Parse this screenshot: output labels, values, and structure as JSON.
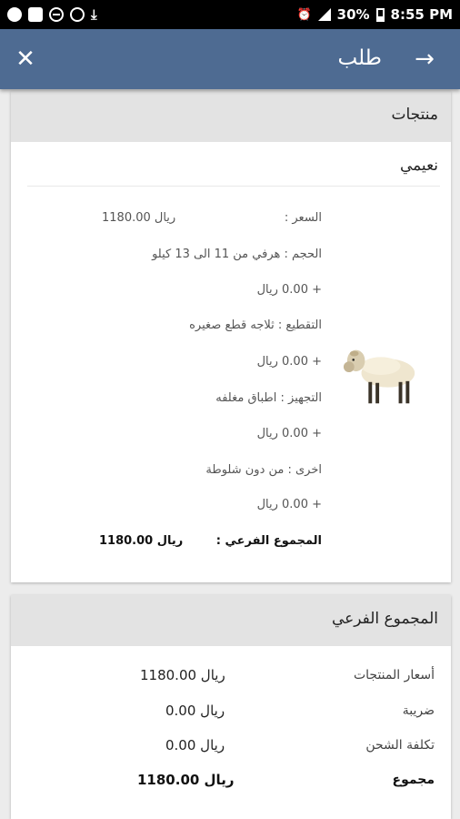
{
  "status_bar": {
    "battery": "30%",
    "time": "8:55 PM",
    "icons": [
      "whatsapp-icon",
      "message-icon",
      "blocked-icon",
      "sync-icon",
      "download-icon",
      "alarm-icon",
      "signal-icon",
      "battery-icon"
    ]
  },
  "header": {
    "title": "طلب",
    "close_icon": "close-icon",
    "back_icon": "arrow-right-icon"
  },
  "products_card": {
    "header": "منتجات",
    "product_name": "نعيمي",
    "image_icon": "sheep-image",
    "price_label": "السعر :",
    "price_value": "1180.00 ريال",
    "size": "الحجم : هرفي من 11 الى 13 كيلو",
    "size_price": "+ 0.00 ريال",
    "cutting": "التقطيع : ثلاجه قطع صغيره",
    "cutting_price": "+ 0.00 ريال",
    "prep": "التجهيز : اطباق مغلفه",
    "prep_price": "+ 0.00 ريال",
    "other": "اخرى : من دون شلوطة",
    "other_price": "+ 0.00 ريال",
    "subtotal_label": "المجموع الفرعي :",
    "subtotal_value": "1180.00 ريال"
  },
  "summary_card": {
    "header": "المجموع الفرعي",
    "rows": [
      {
        "label": "أسعار المنتجات",
        "value": "1180.00 ريال"
      },
      {
        "label": "ضريبة",
        "value": "0.00 ريال"
      },
      {
        "label": "تكلفة الشحن",
        "value": "0.00 ريال"
      },
      {
        "label": "مجموع",
        "value": "1180.00 ريال"
      }
    ]
  },
  "colors": {
    "app_bar": "#4e6b92",
    "card_header": "#e3e3e3",
    "background": "#ececec"
  }
}
